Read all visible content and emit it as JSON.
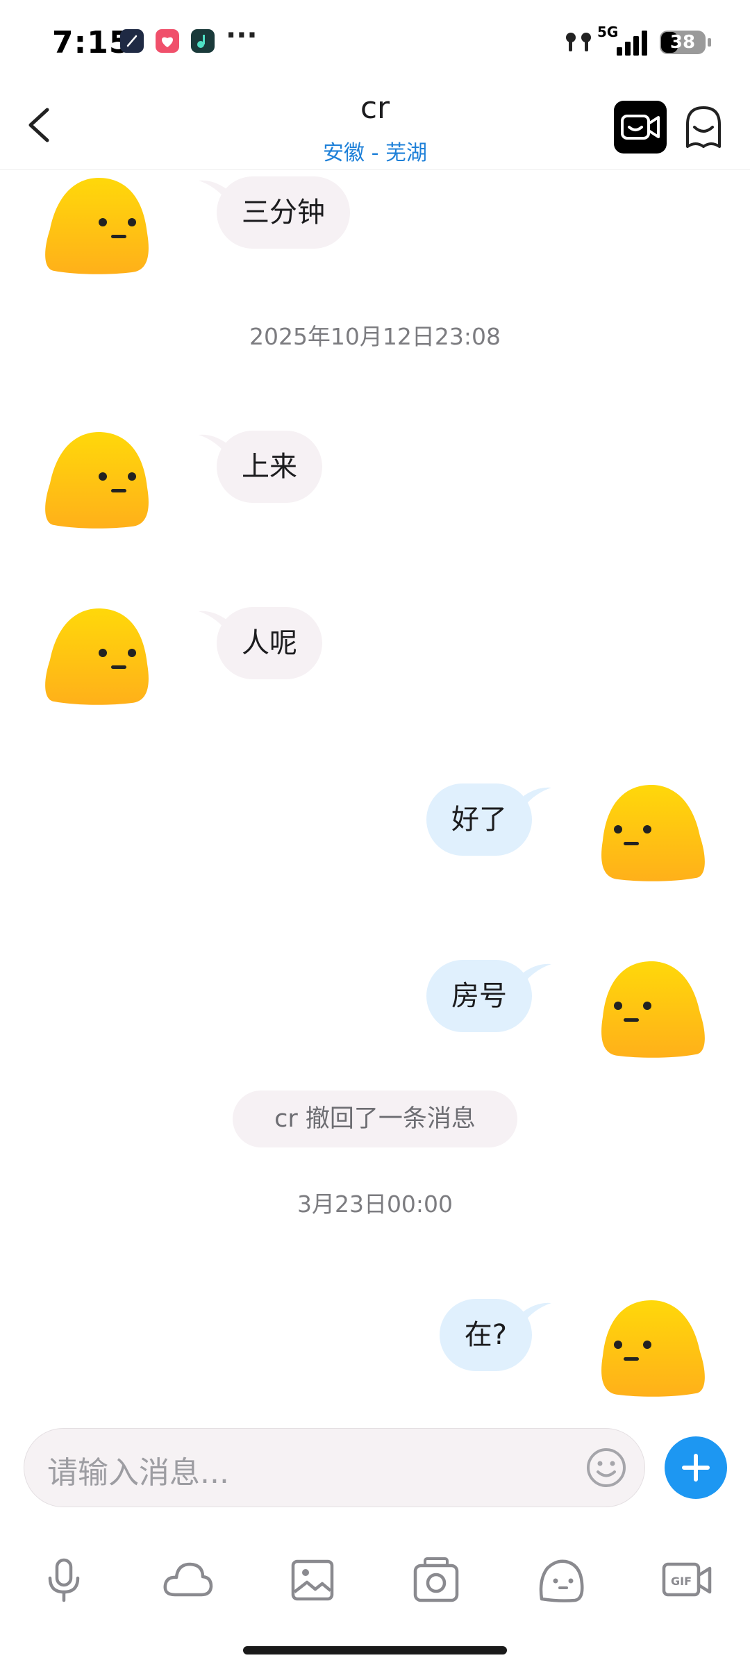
{
  "status_bar": {
    "time": "7:15",
    "network": "5G",
    "battery": "38",
    "more": "···",
    "app_icons": [
      "compass-app-icon",
      "health-app-icon",
      "music-app-icon"
    ]
  },
  "header": {
    "title": "cr",
    "subtitle": "安徽 - 芜湖"
  },
  "messages": [
    {
      "dir": "in",
      "text": "三分钟"
    },
    {
      "type": "timestamp",
      "text": "2025年10月12日23:08"
    },
    {
      "dir": "in",
      "text": "上来"
    },
    {
      "dir": "in",
      "text": "人呢"
    },
    {
      "dir": "out",
      "text": "好了"
    },
    {
      "dir": "out",
      "text": "房号"
    },
    {
      "type": "system",
      "text": "cr 撤回了一条消息"
    },
    {
      "type": "timestamp",
      "text": "3月23日00:00"
    },
    {
      "dir": "out",
      "text": "在?"
    }
  ],
  "input": {
    "placeholder": "请输入消息..."
  },
  "toolbar": [
    "mic-icon",
    "cloud-icon",
    "image-icon",
    "camera-icon",
    "face-icon",
    "gif-icon"
  ],
  "colors": {
    "accent": "#1d97f2",
    "subtitle": "#1e80d8",
    "incoming_bubble": "#f6f1f4",
    "outgoing_bubble": "#e0f0fd",
    "avatar_top": "#ffd70a",
    "avatar_bottom": "#ffb21a"
  }
}
